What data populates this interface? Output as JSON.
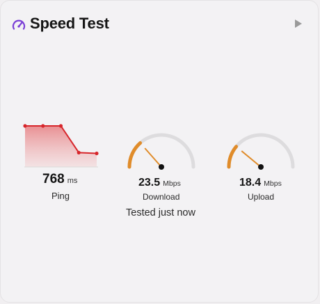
{
  "widget": {
    "title": "Speed Test",
    "accent_color": "#7a3fd6",
    "title_icon": "speedometer-icon",
    "run_icon": "play-icon"
  },
  "ping": {
    "value": "768",
    "unit": "ms",
    "label": "Ping",
    "chart_color": "#d7262b",
    "history": [
      1,
      1,
      1,
      0.35,
      0.33
    ]
  },
  "download": {
    "value": "23.5",
    "unit": "Mbps",
    "label": "Download",
    "gauge_fraction": 0.27,
    "gauge_color": "#e08c2a"
  },
  "upload": {
    "value": "18.4",
    "unit": "Mbps",
    "label": "Upload",
    "gauge_fraction": 0.22,
    "gauge_color": "#e08c2a"
  },
  "status": {
    "text": "Tested just now"
  }
}
